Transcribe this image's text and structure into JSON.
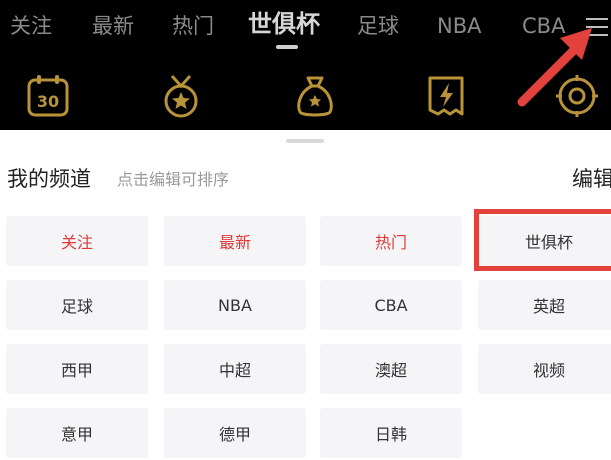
{
  "header": {
    "tabs": [
      {
        "label": "关注",
        "active": false
      },
      {
        "label": "最新",
        "active": false
      },
      {
        "label": "热门",
        "active": false
      },
      {
        "label": "世俱杯",
        "active": true
      },
      {
        "label": "足球",
        "active": false
      },
      {
        "label": "NBA",
        "active": false
      },
      {
        "label": "CBA",
        "active": false
      }
    ],
    "menu_icon": "hamburger-menu-icon",
    "feature_icons": [
      "calendar-30-icon",
      "medal-star-icon",
      "money-bag-icon",
      "lightning-card-icon",
      "lottery-wheel-icon"
    ],
    "accent_color": "#b8933a"
  },
  "sheet": {
    "title": "我的频道",
    "hint": "点击编辑可排序",
    "edit_label": "编辑",
    "channels": [
      {
        "label": "关注",
        "highlight": true
      },
      {
        "label": "最新",
        "highlight": true
      },
      {
        "label": "热门",
        "highlight": true
      },
      {
        "label": "世俱杯",
        "highlight": false
      },
      {
        "label": "足球",
        "highlight": false
      },
      {
        "label": "NBA",
        "highlight": false
      },
      {
        "label": "CBA",
        "highlight": false
      },
      {
        "label": "英超",
        "highlight": false
      },
      {
        "label": "西甲",
        "highlight": false
      },
      {
        "label": "中超",
        "highlight": false
      },
      {
        "label": "澳超",
        "highlight": false
      },
      {
        "label": "视频",
        "highlight": false
      },
      {
        "label": "意甲",
        "highlight": false
      },
      {
        "label": "德甲",
        "highlight": false
      },
      {
        "label": "日韩",
        "highlight": false
      }
    ],
    "highlight_red": "#e03a3a",
    "annotation_color": "#e2413c"
  }
}
